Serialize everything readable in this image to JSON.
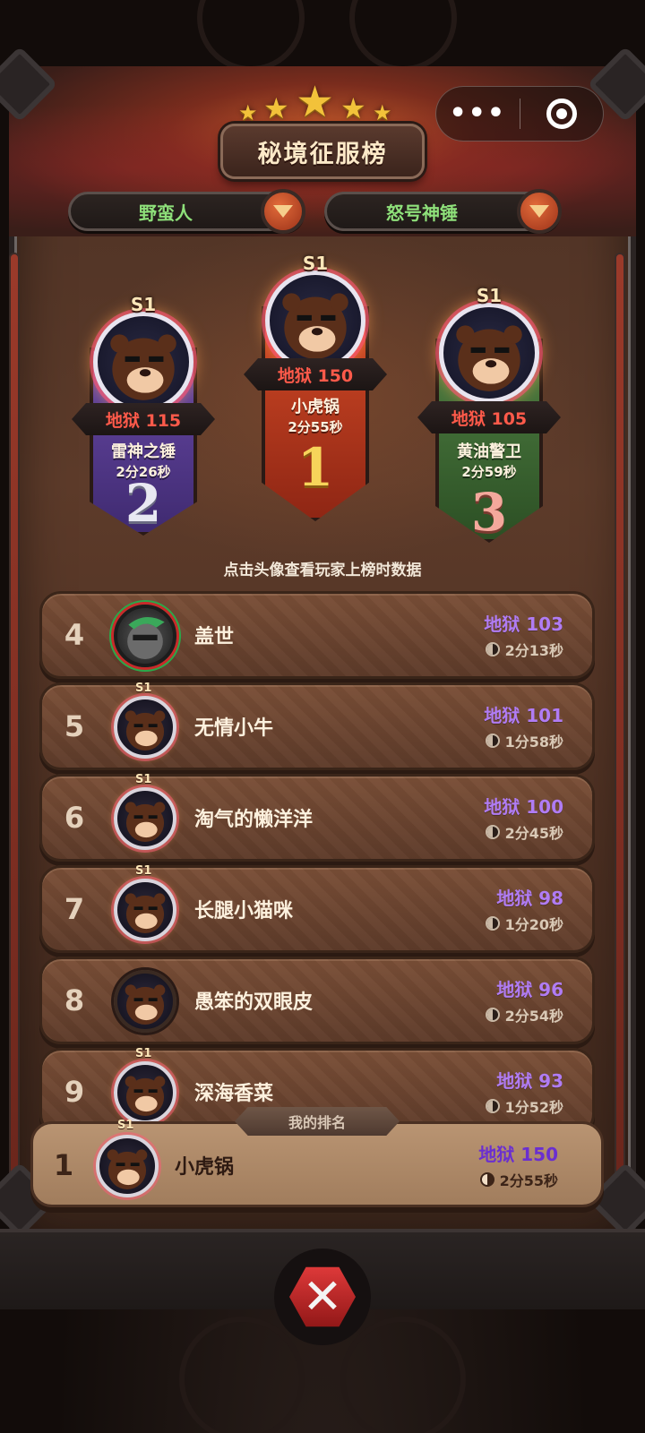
{
  "header": {
    "title": "秘境征服榜",
    "capsule": {
      "more_icon": "ellipsis-icon",
      "close_icon": "target-circle-icon"
    }
  },
  "filters": {
    "class_select": "野蛮人",
    "weapon_select": "怒号神锤"
  },
  "podium": [
    {
      "place": "2",
      "s1": "S1",
      "level": "地狱 115",
      "name": "雷神之锤",
      "time": "2分26秒",
      "color": "#5a3a92"
    },
    {
      "place": "1",
      "s1": "S1",
      "level": "地狱 150",
      "name": "小虎锅",
      "time": "2分55秒",
      "color": "#b8391f"
    },
    {
      "place": "3",
      "s1": "S1",
      "level": "地狱 105",
      "name": "黄油警卫",
      "time": "2分59秒",
      "color": "#3f6a33"
    }
  ],
  "hint": "点击头像查看玩家上榜时数据",
  "rows": [
    {
      "rank": "4",
      "name": "盖世",
      "level": "地狱 103",
      "time": "2分13秒",
      "s1": ""
    },
    {
      "rank": "5",
      "name": "无情小牛",
      "level": "地狱 101",
      "time": "1分58秒",
      "s1": "S1"
    },
    {
      "rank": "6",
      "name": "淘气的懒洋洋",
      "level": "地狱 100",
      "time": "2分45秒",
      "s1": "S1"
    },
    {
      "rank": "7",
      "name": "长腿小猫咪",
      "level": "地狱 98",
      "time": "1分20秒",
      "s1": "S1"
    },
    {
      "rank": "8",
      "name": "愚笨的双眼皮",
      "level": "地狱 96",
      "time": "2分54秒",
      "s1": ""
    },
    {
      "rank": "9",
      "name": "深海香菜",
      "level": "地狱 93",
      "time": "1分52秒",
      "s1": "S1"
    }
  ],
  "mine": {
    "tag": "我的排名",
    "rank": "1",
    "s1": "S1",
    "name": "小虎锅",
    "level": "地狱 150",
    "time": "2分55秒"
  },
  "close_button": "close-x-icon"
}
